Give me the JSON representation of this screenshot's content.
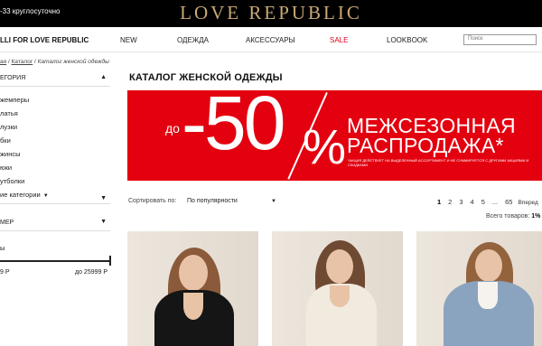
{
  "topbar": {
    "phone": "-33 круглосуточно",
    "logo": "LOVE REPUBLIC"
  },
  "nav": {
    "brand": "LLI FOR LOVE REPUBLIC",
    "items": [
      "NEW",
      "ОДЕЖДА",
      "АКСЕССУАРЫ",
      "SALE",
      "LOOKBOOK"
    ],
    "search_placeholder": "Поиск"
  },
  "breadcrumb": {
    "items": [
      "ая",
      "Каталог",
      "Каталог женской одежды"
    ],
    "separator": "/"
  },
  "sidebar": {
    "category_header": "ЕГОРИЯ",
    "categories": [
      "жемперы",
      "латья",
      "лузки",
      "бки",
      "жинсы",
      "юки",
      "утболки"
    ],
    "more_categories": "ие категории",
    "size_header_top": "",
    "size_header": "МЕР",
    "price_label": "ы",
    "price_from": "9 Р",
    "price_to": "до 25999 Р"
  },
  "main": {
    "title": "КАТАЛОГ ЖЕНСКОЙ ОДЕЖДЫ",
    "banner": {
      "prefix": "до",
      "discount": "-50",
      "percent": "%",
      "line1": "МЕЖСЕЗОННАЯ",
      "line2": "РАСПРОДАЖА*",
      "fine_print": "*АКЦИЯ ДЕЙСТВУЕТ НА ВЫДЕЛЕННЫЙ АССОРТИМЕНТ И НЕ СУММИРУЕТСЯ С ДРУГИМИ АКЦИЯМИ И СКИДКАМИ",
      "color": "#e3000f"
    },
    "sort_label": "Сортировать по:",
    "sort_value": "По популярности",
    "pagination": {
      "pages": [
        "1",
        "2",
        "3",
        "4",
        "5",
        "...",
        "65"
      ],
      "active": "1",
      "next": "Вперед"
    },
    "goods_count_label": "Всего товаров:",
    "goods_count_value": "1%"
  },
  "products": [
    {
      "name": "black-blazer-model"
    },
    {
      "name": "cream-blazer-model"
    },
    {
      "name": "denim-jacket-model"
    }
  ],
  "colors": {
    "accent_red": "#e3000f",
    "sale_red": "#d90024",
    "logo_gold": "#c9a977"
  }
}
